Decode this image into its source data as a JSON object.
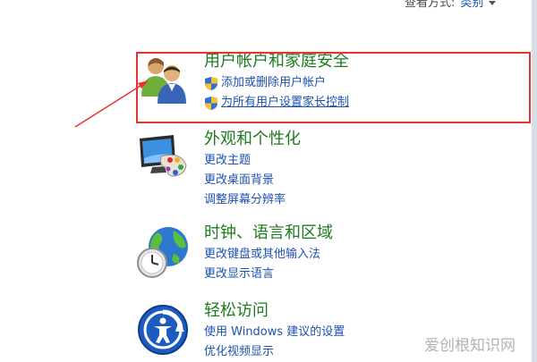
{
  "header": {
    "view_by_label": "查看方式:",
    "view_by_value": "类别"
  },
  "categories": [
    {
      "title": "用户帐户和家庭安全",
      "links": [
        {
          "label": "添加或删除用户帐户",
          "shield": true
        },
        {
          "label": "为所有用户设置家长控制",
          "shield": true
        }
      ]
    },
    {
      "title": "外观和个性化",
      "links": [
        {
          "label": "更改主题",
          "shield": false
        },
        {
          "label": "更改桌面背景",
          "shield": false
        },
        {
          "label": "调整屏幕分辨率",
          "shield": false
        }
      ]
    },
    {
      "title": "时钟、语言和区域",
      "links": [
        {
          "label": "更改键盘或其他输入法",
          "shield": false
        },
        {
          "label": "更改显示语言",
          "shield": false
        }
      ]
    },
    {
      "title": "轻松访问",
      "links": [
        {
          "label": "使用 Windows 建议的设置",
          "shield": false
        },
        {
          "label": "优化视频显示",
          "shield": false
        }
      ]
    }
  ],
  "watermark": "爱创根知识网",
  "colors": {
    "title_green": "#1e7b1e",
    "link_blue": "#1e50b3",
    "annotation_red": "#e8322f"
  }
}
